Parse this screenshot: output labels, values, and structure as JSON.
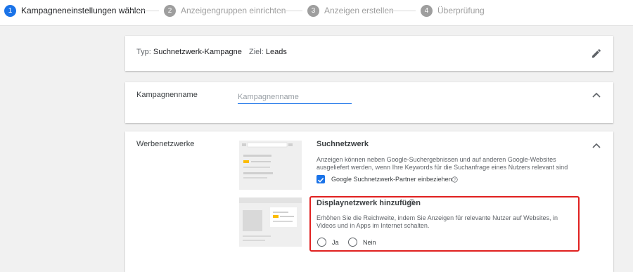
{
  "stepper": {
    "steps": [
      {
        "num": "1",
        "label": "Kampagneneinstellungen wählen"
      },
      {
        "num": "2",
        "label": "Anzeigengruppen einrichten"
      },
      {
        "num": "3",
        "label": "Anzeigen erstellen"
      },
      {
        "num": "4",
        "label": "Überprüfung"
      }
    ],
    "active_index": 0
  },
  "summary": {
    "type_key": "Typ:",
    "type_value": "Suchnetzwerk-Kampagne",
    "goal_key": "Ziel:",
    "goal_value": "Leads"
  },
  "campaign_name": {
    "label": "Kampagnenname",
    "placeholder": "Kampagnenname",
    "value": ""
  },
  "networks": {
    "label": "Werbenetzwerke",
    "search": {
      "title": "Suchnetzwerk",
      "description": "Anzeigen können neben Google-Suchergebnissen und auf anderen Google-Websites ausgeliefert werden, wenn Ihre Keywords für die Suchanfrage eines Nutzers relevant sind",
      "partner_label": "Google Suchnetzwerk-Partner einbeziehen",
      "partner_checked": true
    },
    "display": {
      "title": "Displaynetzwerk hinzufügen",
      "description": "Erhöhen Sie die Reichweite, indem Sie Anzeigen für relevante Nutzer auf Websites, in Videos und in Apps im Internet schalten.",
      "options": [
        "Ja",
        "Nein"
      ]
    }
  },
  "colors": {
    "accent": "#1a73e8",
    "highlight": "#e0201f",
    "illustration_yellow": "#fbbc04"
  }
}
